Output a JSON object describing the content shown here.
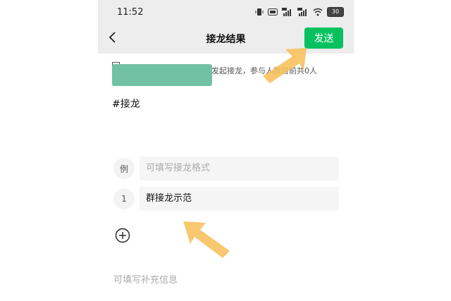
{
  "status_bar": {
    "time": "11:52",
    "icons": [
      "vibrate-icon",
      "hd-icon",
      "signal-4g-icon",
      "signal-4g-icon",
      "wifi-icon",
      "battery-icon"
    ],
    "battery": "30"
  },
  "nav": {
    "title": "接龙结果",
    "send_label": "发送",
    "back_icon": "chevron-left-icon"
  },
  "info": {
    "text": "发起接龙，参与人数目前共0人"
  },
  "hashtag": "#接龙",
  "example": {
    "badge": "例",
    "placeholder": "可填写接龙格式"
  },
  "entries": [
    {
      "index": "1",
      "value": "群接龙示范"
    }
  ],
  "add_icon": "plus-circle-icon",
  "supplement_placeholder": "可填写补充信息",
  "colors": {
    "accent": "#07c160",
    "redaction": "#72c1a4",
    "arrow": "#f7c15e",
    "bar_bg": "#ededed"
  }
}
